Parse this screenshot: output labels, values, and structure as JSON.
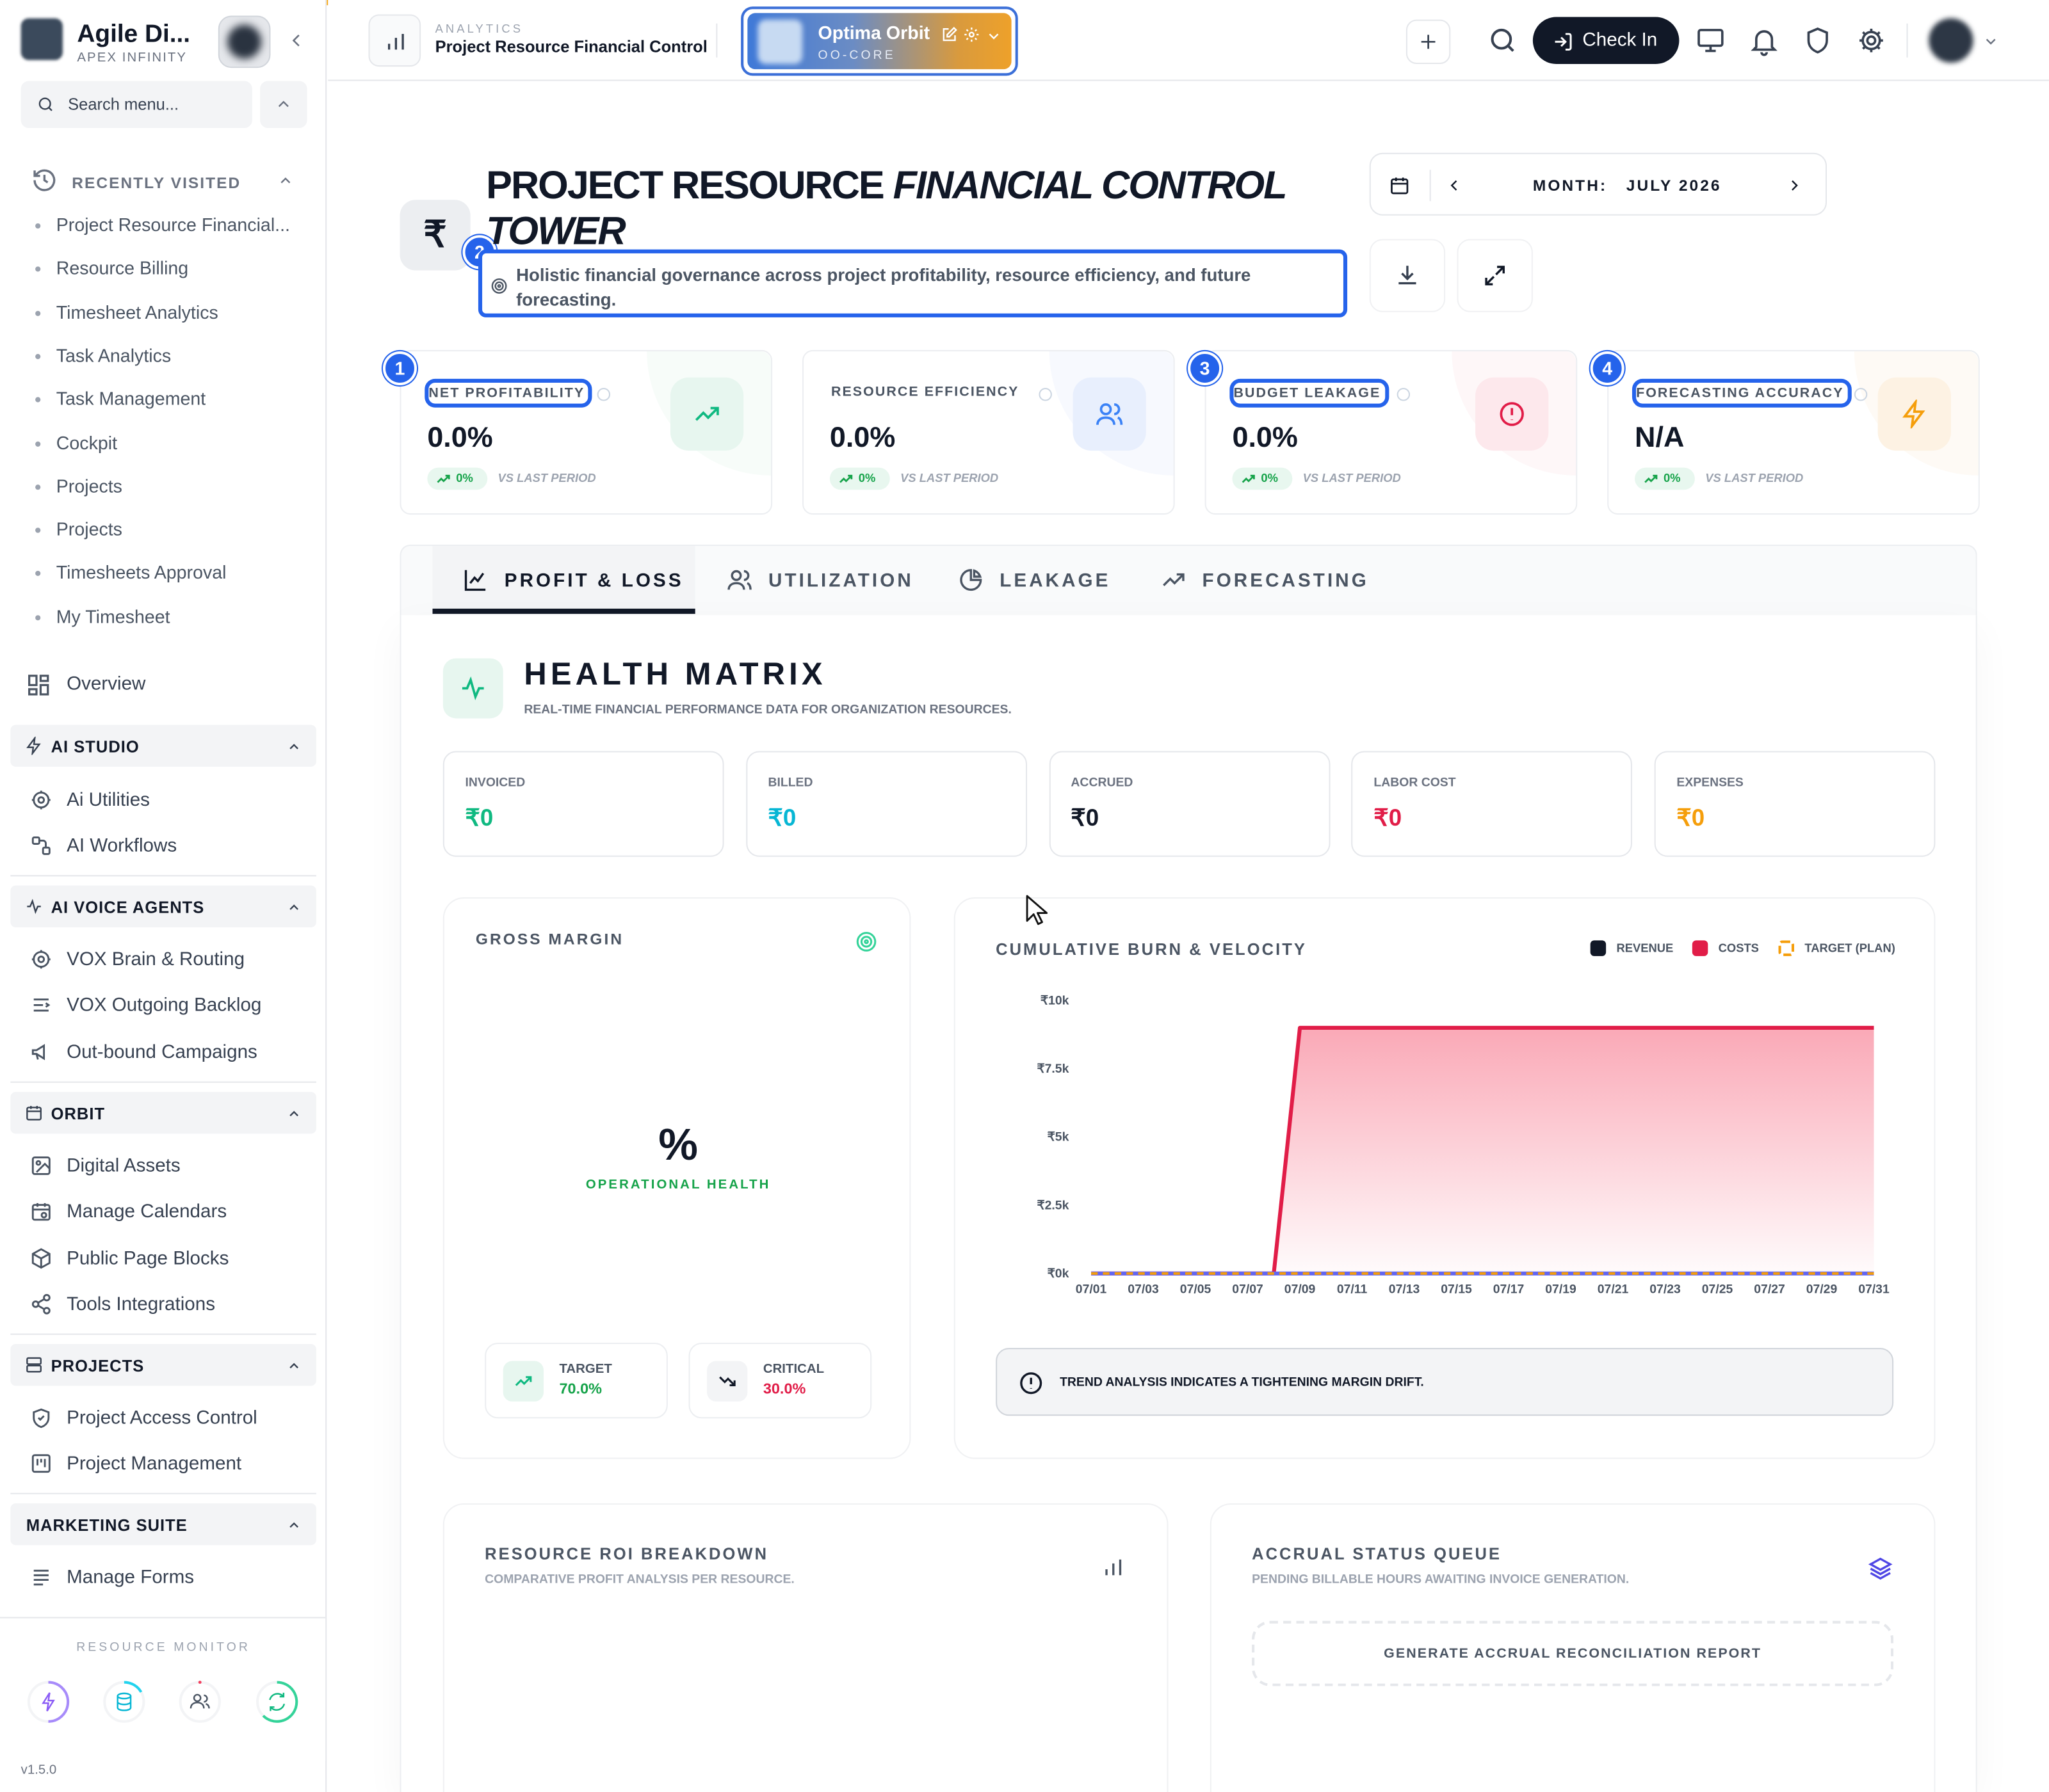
{
  "sidebar": {
    "brand": "Agile Di...",
    "brand_sub": "APEX INFINITY",
    "search_placeholder": "Search menu...",
    "recent_title": "RECENTLY VISITED",
    "recent": [
      "Project Resource Financial...",
      "Resource Billing",
      "Timesheet Analytics",
      "Task Analytics",
      "Task Management",
      "Cockpit",
      "Projects",
      "Projects",
      "Timesheets Approval",
      "My Timesheet"
    ],
    "overview": "Overview",
    "sections": [
      {
        "title": "AI STUDIO",
        "items": [
          {
            "label": "Ai Utilities",
            "icon": "gear-icon"
          },
          {
            "label": "AI Workflows",
            "icon": "workflow-icon"
          }
        ]
      },
      {
        "title": "AI VOICE AGENTS",
        "items": [
          {
            "label": "VOX Brain & Routing",
            "icon": "gear-icon"
          },
          {
            "label": "VOX Outgoing Backlog",
            "icon": "list-icon"
          },
          {
            "label": "Out-bound Campaigns",
            "icon": "megaphone-icon"
          }
        ]
      },
      {
        "title": "ORBIT",
        "items": [
          {
            "label": "Digital Assets",
            "icon": "image-icon"
          },
          {
            "label": "Manage Calendars",
            "icon": "calendar-icon"
          },
          {
            "label": "Public Page Blocks",
            "icon": "cube-icon"
          },
          {
            "label": "Tools Integrations",
            "icon": "share-icon"
          }
        ]
      },
      {
        "title": "PROJECTS",
        "items": [
          {
            "label": "Project Access Control",
            "icon": "shield-icon"
          },
          {
            "label": "Project Management",
            "icon": "kanban-icon"
          }
        ]
      },
      {
        "title": "MARKETING SUITE",
        "items": [
          {
            "label": "Manage Forms",
            "icon": "form-icon"
          }
        ]
      }
    ],
    "resource_monitor": "RESOURCE MONITOR",
    "version": "v1.5.0"
  },
  "header": {
    "section": "ANALYTICS",
    "title": "Project Resource Financial Control",
    "workspace": {
      "name": "Optima Orbit",
      "code": "OO-CORE"
    },
    "check_in": "Check In"
  },
  "page": {
    "currency_symbol": "₹",
    "title_plain": "PROJECT RESOURCE ",
    "title_italic": "FINANCIAL CONTROL TOWER",
    "subtitle": "Holistic financial governance across project profitability, resource efficiency, and future forecasting.",
    "month_label": "MONTH:",
    "month_value": "JULY 2026",
    "markers": [
      "1",
      "2",
      "3",
      "4"
    ]
  },
  "kpis": [
    {
      "label": "NET PROFITABILITY",
      "value": "0.0%",
      "change": "0%",
      "vs": "VS LAST PERIOD",
      "color": "#10b981"
    },
    {
      "label": "RESOURCE EFFICIENCY",
      "value": "0.0%",
      "change": "0%",
      "vs": "VS LAST PERIOD",
      "color": "#3b82f6"
    },
    {
      "label": "BUDGET LEAKAGE",
      "value": "0.0%",
      "change": "0%",
      "vs": "VS LAST PERIOD",
      "color": "#e11d48"
    },
    {
      "label": "FORECASTING ACCURACY",
      "value": "N/A",
      "change": "0%",
      "vs": "VS LAST PERIOD",
      "color": "#f59e0b"
    }
  ],
  "tabs": [
    "PROFIT & LOSS",
    "UTILIZATION",
    "LEAKAGE",
    "FORECASTING"
  ],
  "health": {
    "title": "HEALTH MATRIX",
    "subtitle": "REAL-TIME FINANCIAL PERFORMANCE DATA FOR ORGANIZATION RESOURCES.",
    "metrics": [
      {
        "label": "INVOICED",
        "value": "₹0",
        "color": "#10b981"
      },
      {
        "label": "BILLED",
        "value": "₹0",
        "color": "#06b6d4"
      },
      {
        "label": "ACCRUED",
        "value": "₹0",
        "color": "#111827"
      },
      {
        "label": "LABOR COST",
        "value": "₹0",
        "color": "#e11d48"
      },
      {
        "label": "EXPENSES",
        "value": "₹0",
        "color": "#f59e0b"
      }
    ]
  },
  "gross_margin": {
    "title": "GROSS MARGIN",
    "value": "%",
    "caption": "OPERATIONAL HEALTH",
    "target_label": "TARGET",
    "target_value": "70.0%",
    "critical_label": "CRITICAL",
    "critical_value": "30.0%"
  },
  "burn": {
    "title": "CUMULATIVE BURN & VELOCITY",
    "trend_note": "TREND ANALYSIS INDICATES A TIGHTENING MARGIN DRIFT."
  },
  "chart_data": {
    "type": "area",
    "title": "CUMULATIVE BURN & VELOCITY",
    "x_ticks": [
      "07/01",
      "07/03",
      "07/05",
      "07/07",
      "07/09",
      "07/11",
      "07/13",
      "07/15",
      "07/17",
      "07/19",
      "07/21",
      "07/23",
      "07/25",
      "07/27",
      "07/29",
      "07/31"
    ],
    "y_ticks": [
      "₹0k",
      "₹2.5k",
      "₹5k",
      "₹7.5k",
      "₹10k"
    ],
    "ylim": [
      0,
      10000
    ],
    "x": [
      "07/01",
      "07/02",
      "07/03",
      "07/04",
      "07/05",
      "07/06",
      "07/07",
      "07/08",
      "07/09",
      "07/10",
      "07/11",
      "07/12",
      "07/13",
      "07/14",
      "07/15",
      "07/16",
      "07/17",
      "07/18",
      "07/19",
      "07/20",
      "07/21",
      "07/22",
      "07/23",
      "07/24",
      "07/25",
      "07/26",
      "07/27",
      "07/28",
      "07/29",
      "07/30",
      "07/31"
    ],
    "series": [
      {
        "name": "REVENUE",
        "color": "#111827",
        "values": [
          0,
          0,
          0,
          0,
          0,
          0,
          0,
          0,
          0,
          0,
          0,
          0,
          0,
          0,
          0,
          0,
          0,
          0,
          0,
          0,
          0,
          0,
          0,
          0,
          0,
          0,
          0,
          0,
          0,
          0,
          0
        ]
      },
      {
        "name": "COSTS",
        "color": "#e11d48",
        "values": [
          0,
          0,
          0,
          0,
          0,
          0,
          0,
          0,
          9000,
          9000,
          9000,
          9000,
          9000,
          9000,
          9000,
          9000,
          9000,
          9000,
          9000,
          9000,
          9000,
          9000,
          9000,
          9000,
          9000,
          9000,
          9000,
          9000,
          9000,
          9000,
          9000
        ]
      },
      {
        "name": "TARGET (PLAN)",
        "color": "#f59e0b",
        "values": [
          0,
          0,
          0,
          0,
          0,
          0,
          0,
          0,
          0,
          0,
          0,
          0,
          0,
          0,
          0,
          0,
          0,
          0,
          0,
          0,
          0,
          0,
          0,
          0,
          0,
          0,
          0,
          0,
          0,
          0,
          0
        ]
      }
    ],
    "legend": "top-right"
  },
  "roi": {
    "title": "RESOURCE ROI BREAKDOWN",
    "subtitle": "COMPARATIVE PROFIT ANALYSIS PER RESOURCE."
  },
  "accrual": {
    "title": "ACCRUAL STATUS QUEUE",
    "subtitle": "PENDING BILLABLE HOURS AWAITING INVOICE GENERATION.",
    "action": "GENERATE ACCRUAL RECONCILIATION REPORT"
  }
}
